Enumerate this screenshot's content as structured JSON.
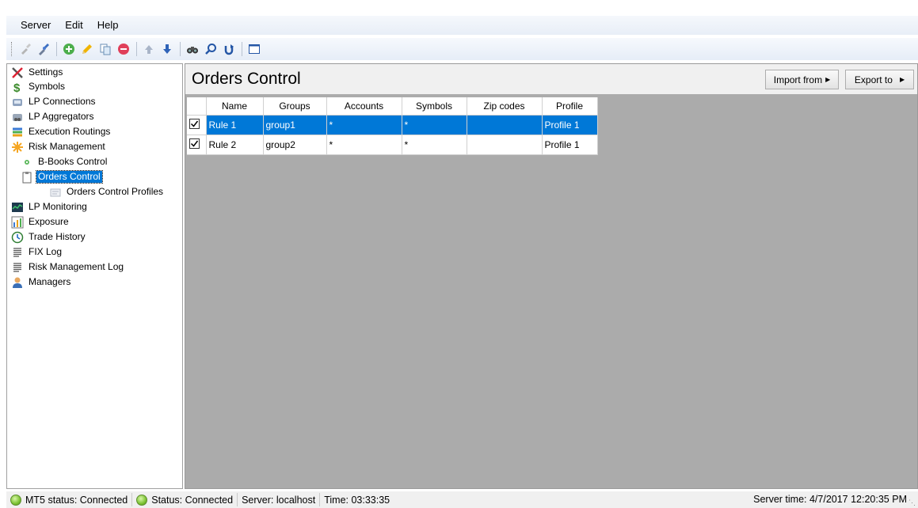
{
  "menu": [
    "Server",
    "Edit",
    "Help"
  ],
  "toolbar": {
    "buttons": [
      "connect-icon",
      "disconnect-icon",
      "add-icon",
      "edit-icon",
      "copy-icon",
      "delete-icon",
      "move-up-icon",
      "move-down-icon",
      "find-icon",
      "search-icon",
      "refresh-icon",
      "window-icon"
    ]
  },
  "tree": {
    "items": [
      {
        "label": "Settings",
        "icon": "settings-icon"
      },
      {
        "label": "Symbols",
        "icon": "symbols-icon"
      },
      {
        "label": "LP Connections",
        "icon": "lp-connections-icon"
      },
      {
        "label": "LP Aggregators",
        "icon": "lp-aggregators-icon"
      },
      {
        "label": "Execution Routings",
        "icon": "execution-routings-icon"
      },
      {
        "label": "Risk Management",
        "icon": "risk-management-icon"
      },
      {
        "label": "B-Books Control",
        "icon": "b-books-icon"
      },
      {
        "label": "Orders Control",
        "icon": "orders-control-icon"
      },
      {
        "label": "Orders Control Profiles",
        "icon": "profiles-icon"
      },
      {
        "label": "LP Monitoring",
        "icon": "lp-monitoring-icon"
      },
      {
        "label": "Exposure",
        "icon": "exposure-icon"
      },
      {
        "label": "Trade History",
        "icon": "trade-history-icon"
      },
      {
        "label": "FIX Log",
        "icon": "fix-log-icon"
      },
      {
        "label": "Risk Management Log",
        "icon": "risk-log-icon"
      },
      {
        "label": "Managers",
        "icon": "managers-icon"
      }
    ]
  },
  "main": {
    "title": "Orders Control",
    "import_label": "Import from",
    "export_label": "Export to",
    "columns": [
      "",
      "Name",
      "Groups",
      "Accounts",
      "Symbols",
      "Zip codes",
      "Profile"
    ],
    "rows": [
      {
        "checked": true,
        "name": "Rule 1",
        "groups": "group1",
        "accounts": "*",
        "symbols": "*",
        "zip": "",
        "profile": "Profile 1"
      },
      {
        "checked": true,
        "name": "Rule 2",
        "groups": "group2",
        "accounts": "*",
        "symbols": "*",
        "zip": "",
        "profile": "Profile 1"
      }
    ]
  },
  "status": {
    "mt5": "MT5 status: Connected",
    "status": "Status: Connected",
    "server": "Server: localhost",
    "time": "Time: 03:33:35",
    "server_time": "Server time: 4/7/2017 12:20:35 PM"
  }
}
